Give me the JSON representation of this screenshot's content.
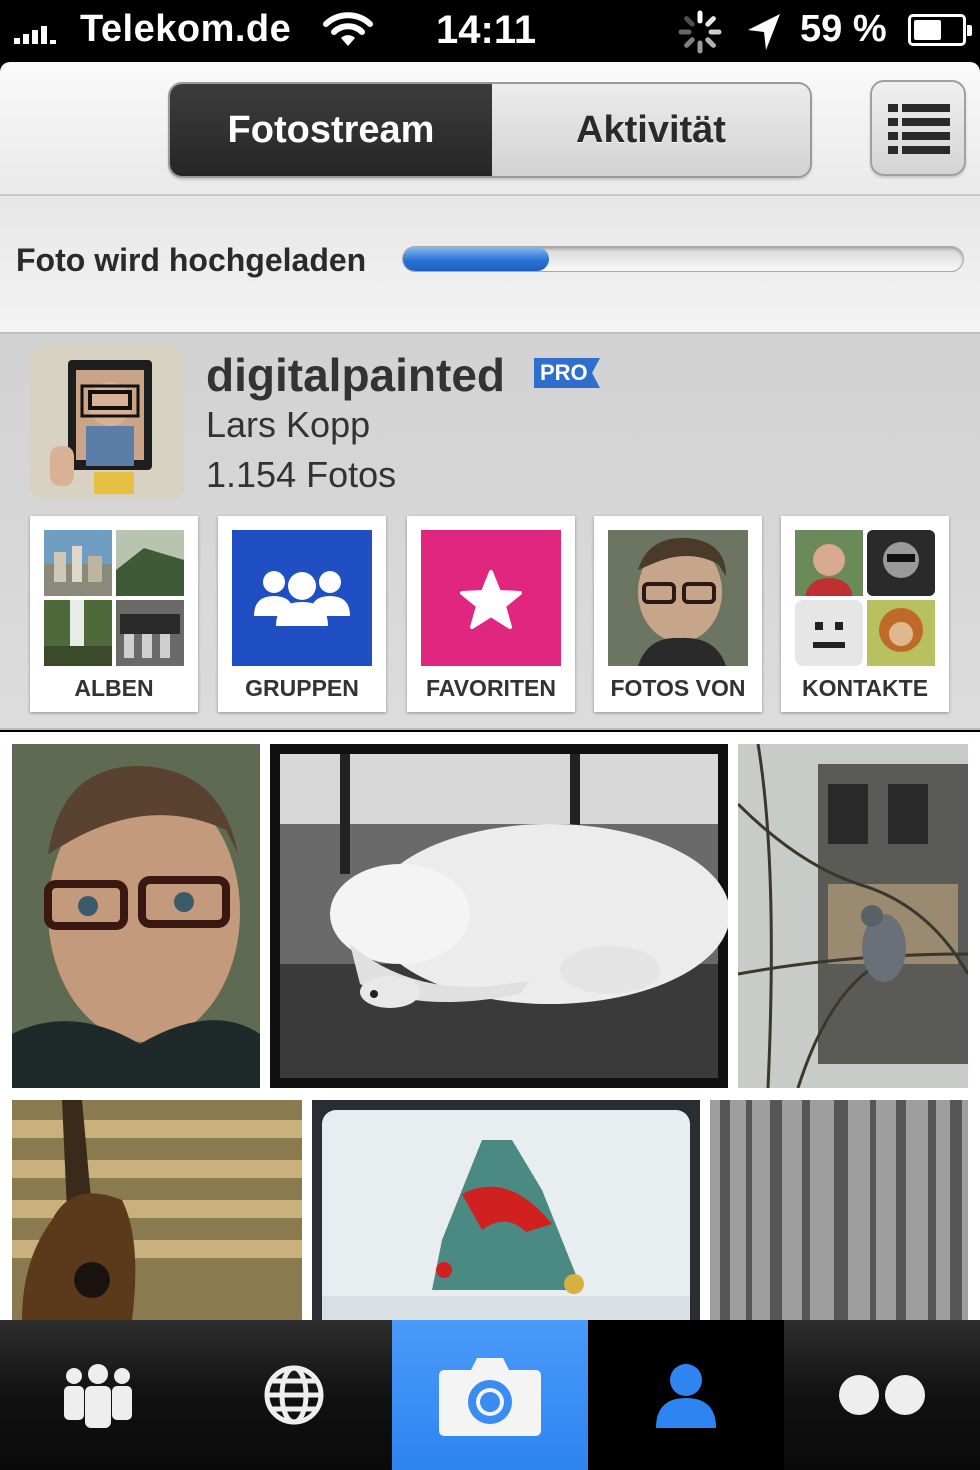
{
  "status_bar": {
    "carrier": "Telekom.de",
    "time": "14:11",
    "battery_text": "59 %",
    "battery_level": 0.59
  },
  "header": {
    "tabs": [
      {
        "label": "Fotostream",
        "active": true
      },
      {
        "label": "Aktivität",
        "active": false
      }
    ],
    "menu_icon": "list-icon"
  },
  "upload": {
    "label": "Foto wird hochgeladen",
    "progress": 0.26
  },
  "profile": {
    "username": "digitalpainted",
    "badge": "PRO",
    "real_name": "Lars Kopp",
    "photo_count": "1.154 Fotos",
    "tiles": [
      {
        "label": "ALBEN",
        "icon": "album-collage"
      },
      {
        "label": "GRUPPEN",
        "icon": "groups-icon",
        "color": "#1f4fc2"
      },
      {
        "label": "FAVORITEN",
        "icon": "star-icon",
        "color": "#e0267e"
      },
      {
        "label": "FOTOS VON",
        "icon": "portrait-photo"
      },
      {
        "label": "KONTAKTE",
        "icon": "contacts-collage"
      }
    ]
  },
  "tab_bar": {
    "items": [
      {
        "name": "contacts",
        "icon": "people-icon"
      },
      {
        "name": "explore",
        "icon": "globe-icon"
      },
      {
        "name": "camera",
        "icon": "camera-icon",
        "highlight": true
      },
      {
        "name": "you",
        "icon": "person-icon",
        "selected": true
      },
      {
        "name": "flickr",
        "icon": "flickr-dots-icon"
      }
    ]
  },
  "colors": {
    "accent": "#2e84f0",
    "pro_badge": "#2f6ecd",
    "groups_tile": "#1f4fc2",
    "favorites_tile": "#e0267e"
  }
}
